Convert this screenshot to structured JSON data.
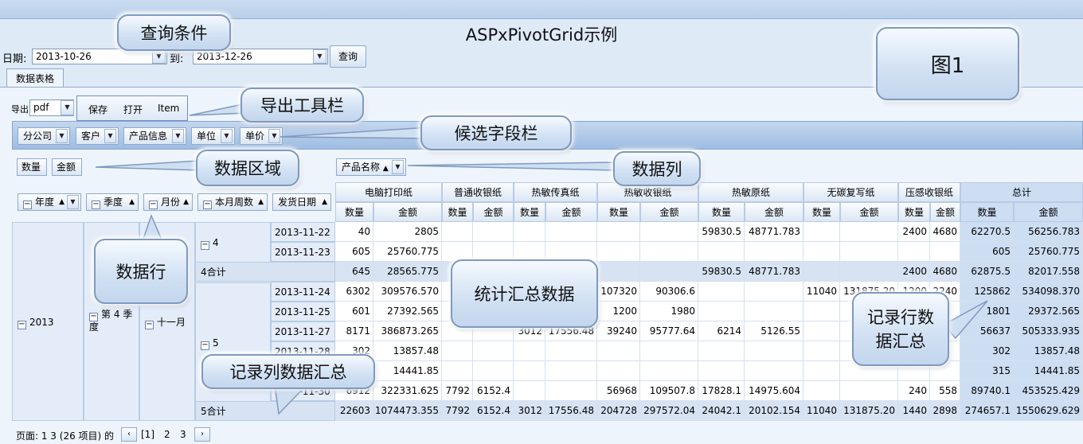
{
  "page_title": "ASPxPivotGrid示例",
  "query": {
    "date_label": "日期:",
    "from_value": "2013-10-26",
    "to_label": "到:",
    "to_value": "2013-12-26",
    "button": "查询"
  },
  "tab": "数据表格",
  "export": {
    "label": "导出",
    "format": "pdf",
    "buttons": [
      "保存",
      "打开",
      "Item"
    ]
  },
  "filter_fields": [
    "分公司",
    "客户",
    "产品信息",
    "单位",
    "单价"
  ],
  "data_fields": [
    "数量",
    "金额"
  ],
  "column_field": "产品名称",
  "row_fields": [
    "年度",
    "季度",
    "月份",
    "本月周数",
    "发货日期"
  ],
  "products": [
    "电脑打印纸",
    "普通收银纸",
    "热敏传真纸",
    "热敏收银纸",
    "热敏原纸",
    "无碳复写纸",
    "压感收银纸",
    "总计"
  ],
  "measures": [
    "数量",
    "金额"
  ],
  "row_dims": {
    "year": "2013",
    "quarter": "第 4 季度",
    "month": "十一月",
    "week4": "4",
    "week4_total": "4合计",
    "week5": "5",
    "week5_total": "5合计"
  },
  "rows": [
    {
      "date": "2013-11-22",
      "v": [
        "40",
        "2805",
        "",
        "",
        "",
        "",
        "",
        "",
        "59830.5",
        "48771.783",
        "",
        "",
        "2400",
        "4680",
        "62270.5",
        "56256.783"
      ]
    },
    {
      "date": "2013-11-23",
      "v": [
        "605",
        "25760.775",
        "",
        "",
        "",
        "",
        "",
        "",
        "",
        "",
        "",
        "",
        "",
        "",
        "605",
        "25760.775"
      ]
    },
    {
      "date": "4合计",
      "v": [
        "645",
        "28565.775",
        "",
        "",
        "",
        "",
        "",
        "",
        "59830.5",
        "48771.783",
        "",
        "",
        "2400",
        "4680",
        "62875.5",
        "82017.558"
      ]
    },
    {
      "date": "2013-11-24",
      "v": [
        "6302",
        "309576.570",
        "",
        "",
        "",
        "",
        "107320",
        "90306.6",
        "",
        "",
        "11040",
        "131875.20",
        "1200",
        "2240",
        "125862",
        "534098.370"
      ]
    },
    {
      "date": "2013-11-25",
      "v": [
        "601",
        "27392.565",
        "",
        "",
        "",
        "",
        "1200",
        "1980",
        "",
        "",
        "",
        "",
        "",
        "",
        "1801",
        "29372.565"
      ]
    },
    {
      "date": "2013-11-27",
      "v": [
        "8171",
        "386873.265",
        "",
        "",
        "3012",
        "17556.48",
        "39240",
        "95777.64",
        "6214",
        "5126.55",
        "",
        "",
        "",
        "",
        "56637",
        "505333.935"
      ]
    },
    {
      "date": "2013-11-28",
      "v": [
        "302",
        "13857.48",
        "",
        "",
        "",
        "",
        "",
        "",
        "",
        "",
        "",
        "",
        "",
        "",
        "302",
        "13857.48"
      ]
    },
    {
      "date": "2013-11-29",
      "v": [
        "315",
        "14441.85",
        "",
        "",
        "",
        "",
        "",
        "",
        "",
        "",
        "",
        "",
        "",
        "",
        "315",
        "14441.85"
      ]
    },
    {
      "date": "2013-11-30",
      "v": [
        "6912",
        "322331.625",
        "7792",
        "6152.4",
        "",
        "",
        "56968",
        "109507.8",
        "17828.1",
        "14975.604",
        "",
        "",
        "240",
        "558",
        "89740.1",
        "453525.429"
      ]
    },
    {
      "date": "5合计",
      "v": [
        "22603",
        "1074473.355",
        "7792",
        "6152.4",
        "3012",
        "17556.48",
        "204728",
        "297572.04",
        "24042.1",
        "20102.154",
        "11040",
        "131875.20",
        "1440",
        "2898",
        "274657.1",
        "1550629.629"
      ]
    }
  ],
  "pager": {
    "text": "页面: 1 3 (26 项目) 的",
    "prev": "‹",
    "pages": [
      "[1]",
      "2",
      "3"
    ],
    "next": "›"
  },
  "callouts": {
    "query": "查询条件",
    "fig": "图1",
    "export": "导出工具栏",
    "filter": "候选字段栏",
    "data_area": "数据区域",
    "data_col": "数据列",
    "data_row": "数据行",
    "summary": "统计汇总数据",
    "row_total": "记录行数据汇总",
    "col_total": "记录列数据汇总"
  }
}
